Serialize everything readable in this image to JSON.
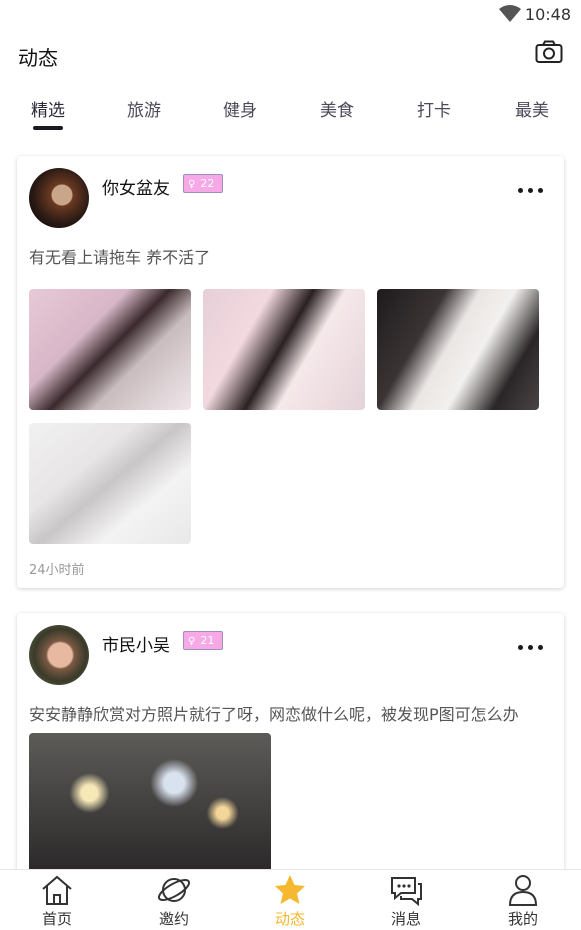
{
  "status_bar": {
    "time": "10:48",
    "icons": [
      "wifi-icon"
    ]
  },
  "header": {
    "title": "动态",
    "icon": "camera-icon"
  },
  "tabs": [
    {
      "label": "精选",
      "active": true
    },
    {
      "label": "旅游",
      "active": false
    },
    {
      "label": "健身",
      "active": false
    },
    {
      "label": "美食",
      "active": false
    },
    {
      "label": "打卡",
      "active": false
    },
    {
      "label": "最美",
      "active": false
    }
  ],
  "posts": [
    {
      "username": "你女盆友",
      "badge": {
        "gender": "♀",
        "age": "22"
      },
      "text": "有无看上请拖车  养不活了",
      "photo_count": 4,
      "time_ago": "24小时前"
    },
    {
      "username": "市民小吴",
      "badge": {
        "gender": "♀",
        "age": "21"
      },
      "text": "安安静静欣赏对方照片就行了呀，网恋做什么呢，被发现P图可怎么办",
      "photo_count": 1
    }
  ],
  "bottom_nav": [
    {
      "label": "首页",
      "icon": "home-icon",
      "active": false
    },
    {
      "label": "邀约",
      "icon": "planet-icon",
      "active": false
    },
    {
      "label": "动态",
      "icon": "star-icon",
      "active": true
    },
    {
      "label": "消息",
      "icon": "chat-icon",
      "active": false
    },
    {
      "label": "我的",
      "icon": "user-icon",
      "active": false
    }
  ],
  "colors": {
    "accent": "#f5b82e",
    "badge_bg": "#f6a9e6",
    "tab_indicator": "#1b1b24"
  }
}
